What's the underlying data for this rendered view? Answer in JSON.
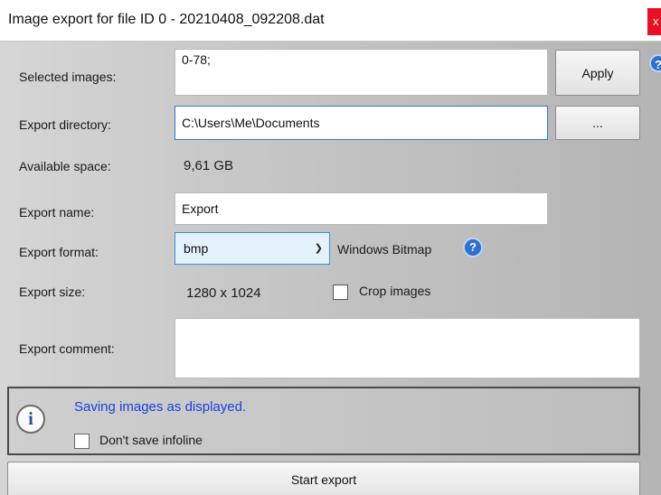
{
  "window": {
    "title": "Image export for file ID 0  -  20210408_092208.dat",
    "close_glyph": "x",
    "help_glyph": "?"
  },
  "form": {
    "selected_images": {
      "label": "Selected images:",
      "value": "0-78;",
      "apply_label": "Apply"
    },
    "export_directory": {
      "label": "Export directory:",
      "value": "C:\\Users\\Me\\Documents",
      "browse_label": "..."
    },
    "available_space": {
      "label": "Available space:",
      "value": "9,61 GB"
    },
    "export_name": {
      "label": "Export name:",
      "value": "Export"
    },
    "export_format": {
      "label": "Export format:",
      "value": "bmp",
      "description": "Windows Bitmap",
      "help_glyph": "?"
    },
    "export_size": {
      "label": "Export size:",
      "value": "1280 x 1024",
      "crop_label": "Crop images",
      "crop_checked": false
    },
    "export_comment": {
      "label": "Export comment:",
      "value": ""
    }
  },
  "info": {
    "icon_glyph": "i",
    "message": "Saving images as displayed.",
    "infoline_label": "Don't save infoline",
    "infoline_checked": false
  },
  "actions": {
    "start_label": "Start export"
  },
  "colors": {
    "accent_blue": "#2a78d6",
    "info_text": "#1b3fe0",
    "close_red": "#e81123"
  },
  "icons": {
    "close": "close-icon",
    "help": "help-icon",
    "info": "info-icon",
    "dropdown": "chevron-down-icon"
  }
}
